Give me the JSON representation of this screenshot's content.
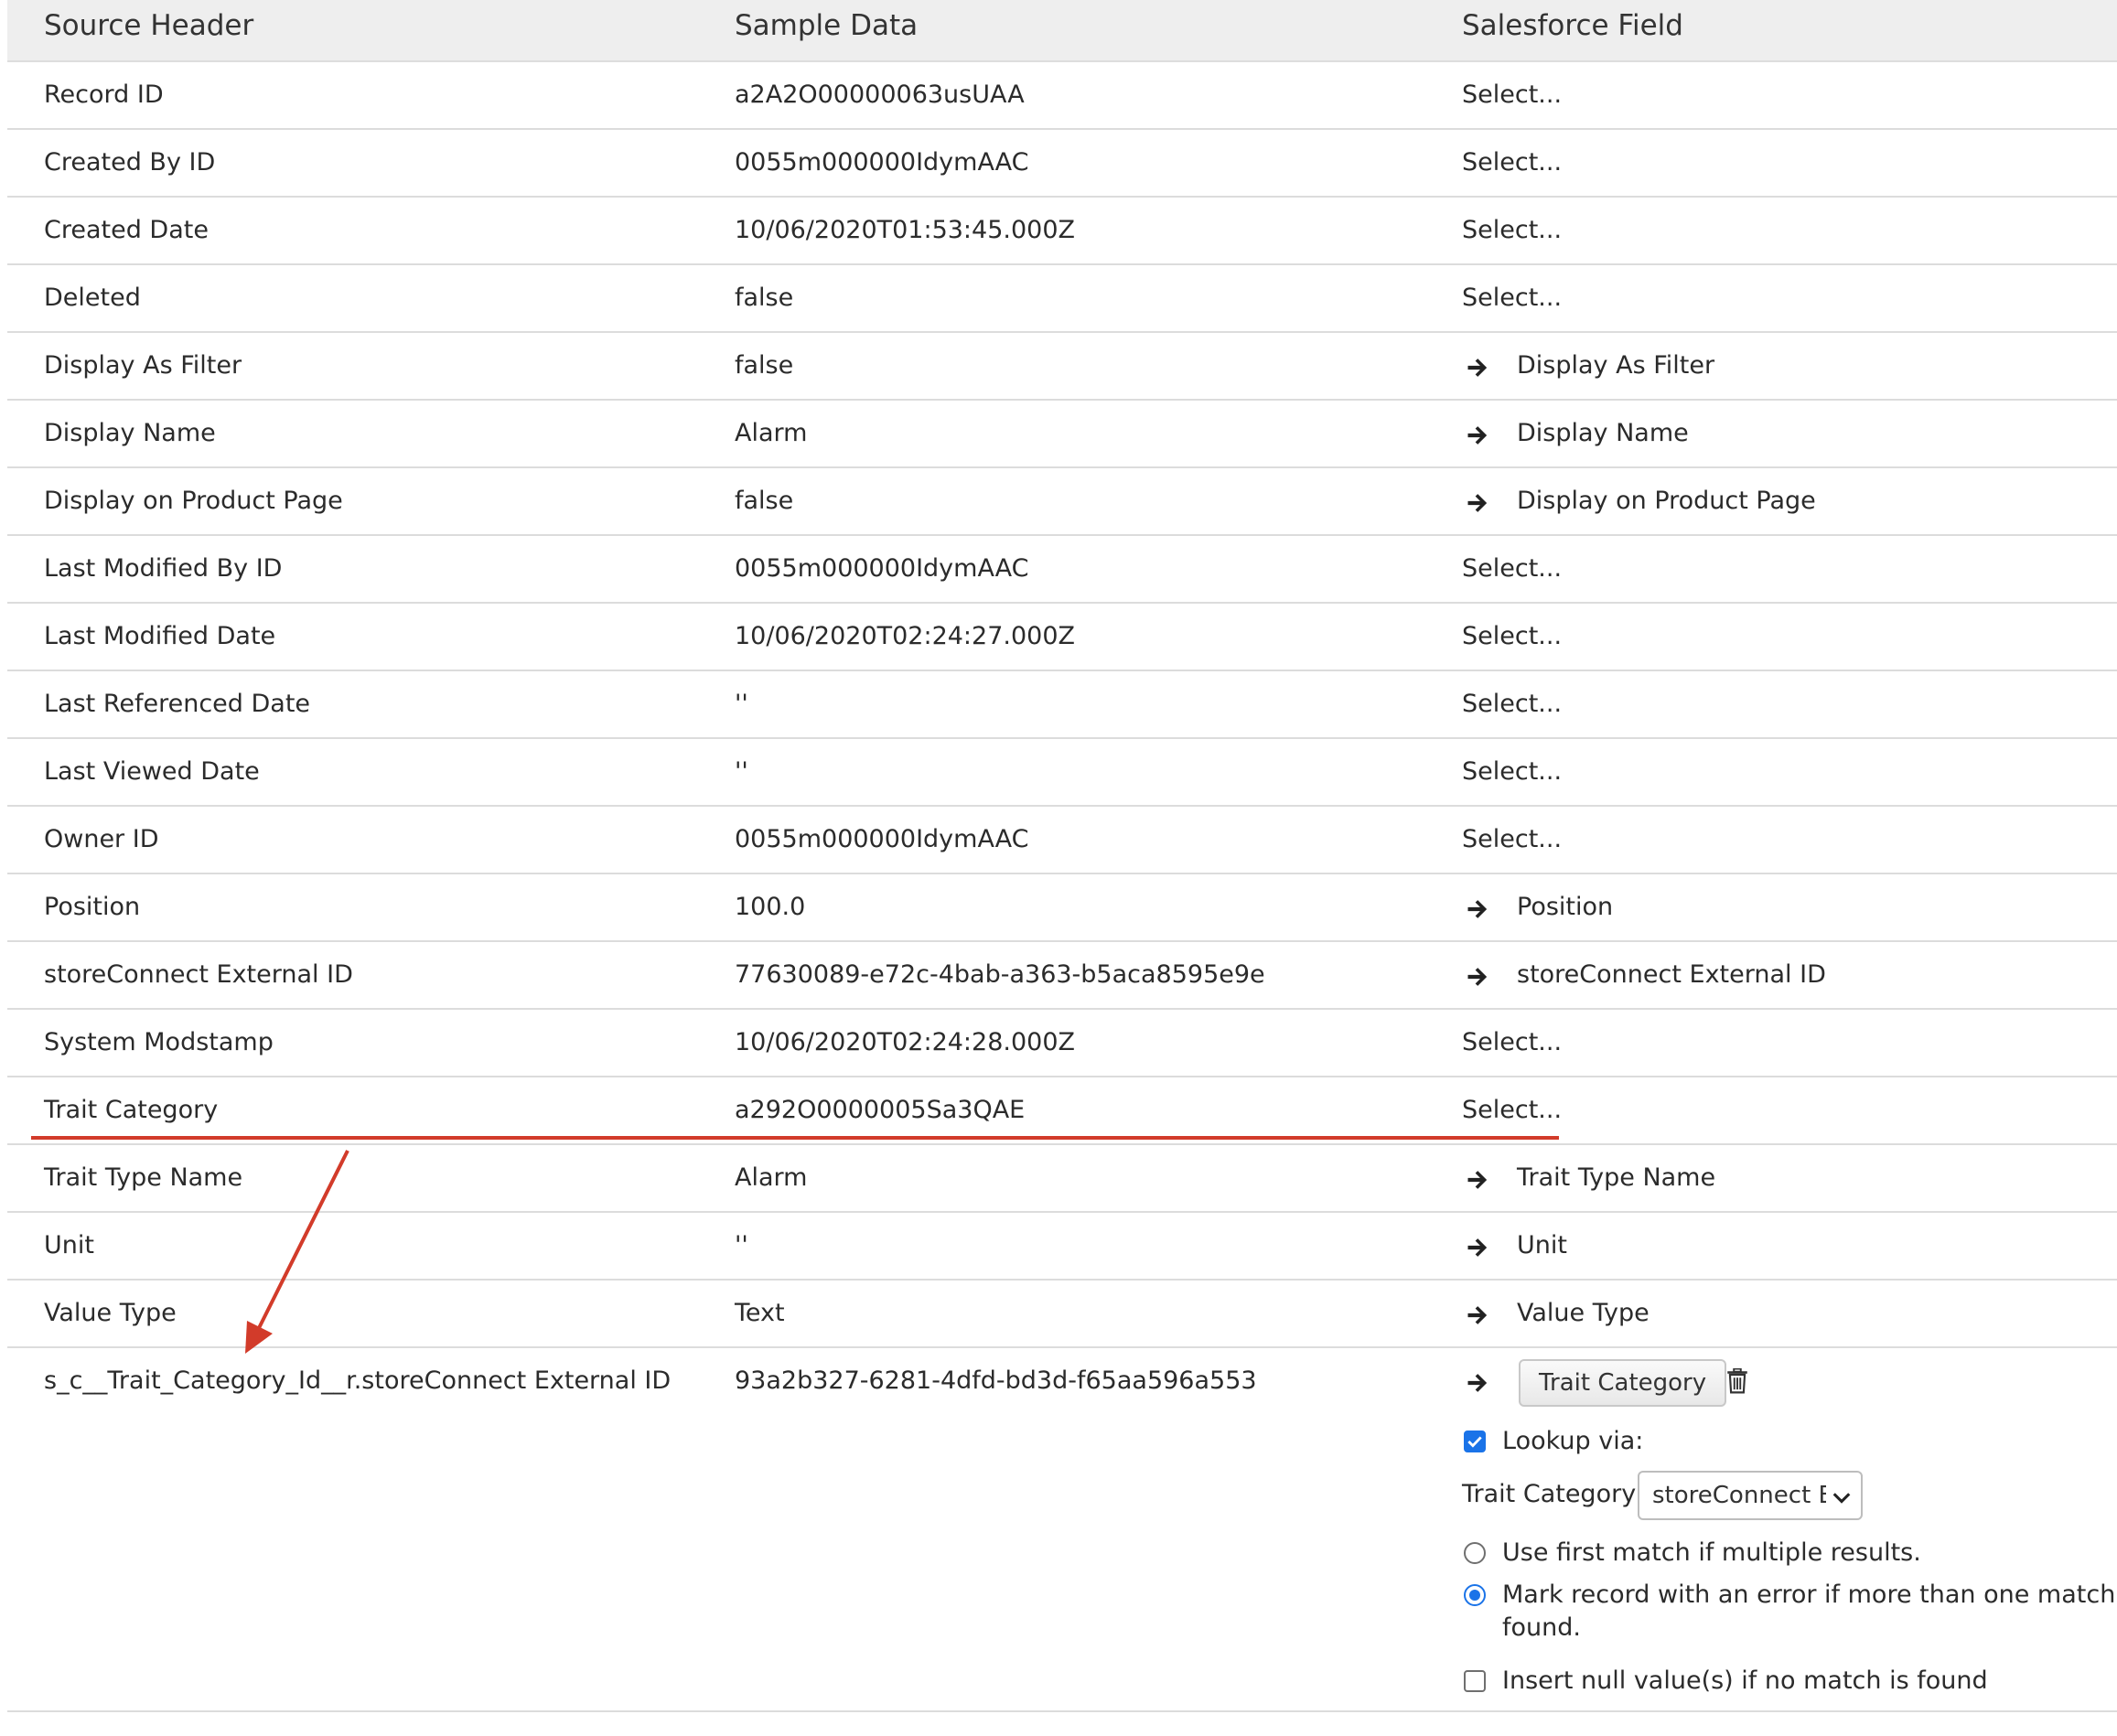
{
  "header": {
    "source_header": "Source Header",
    "sample_data": "Sample Data",
    "salesforce_field": "Salesforce Field"
  },
  "rows": [
    {
      "source": "Record ID",
      "sample": "a2A2O00000063usUAA",
      "field": "Select...",
      "mapped": false
    },
    {
      "source": "Created By ID",
      "sample": "0055m000000IdymAAC",
      "field": "Select...",
      "mapped": false
    },
    {
      "source": "Created Date",
      "sample": "10/06/2020T01:53:45.000Z",
      "field": "Select...",
      "mapped": false
    },
    {
      "source": "Deleted",
      "sample": "false",
      "field": "Select...",
      "mapped": false
    },
    {
      "source": "Display As Filter",
      "sample": "false",
      "field": "Display As Filter",
      "mapped": true
    },
    {
      "source": "Display Name",
      "sample": "Alarm",
      "field": "Display Name",
      "mapped": true
    },
    {
      "source": "Display on Product Page",
      "sample": "false",
      "field": "Display on Product Page",
      "mapped": true
    },
    {
      "source": "Last Modified By ID",
      "sample": "0055m000000IdymAAC",
      "field": "Select...",
      "mapped": false
    },
    {
      "source": "Last Modified Date",
      "sample": "10/06/2020T02:24:27.000Z",
      "field": "Select...",
      "mapped": false
    },
    {
      "source": "Last Referenced Date",
      "sample": "''",
      "field": "Select...",
      "mapped": false
    },
    {
      "source": "Last Viewed Date",
      "sample": "''",
      "field": "Select...",
      "mapped": false
    },
    {
      "source": "Owner ID",
      "sample": "0055m000000IdymAAC",
      "field": "Select...",
      "mapped": false
    },
    {
      "source": "Position",
      "sample": "100.0",
      "field": "Position",
      "mapped": true
    },
    {
      "source": "storeConnect External ID",
      "sample": "77630089-e72c-4bab-a363-b5aca8595e9e",
      "field": "storeConnect External ID",
      "mapped": true
    },
    {
      "source": "System Modstamp",
      "sample": "10/06/2020T02:24:28.000Z",
      "field": "Select...",
      "mapped": false
    },
    {
      "source": "Trait Category",
      "sample": "a292O0000005Sa3QAE",
      "field": "Select...",
      "mapped": false
    },
    {
      "source": "Trait Type Name",
      "sample": "Alarm",
      "field": "Trait Type Name",
      "mapped": true
    },
    {
      "source": "Unit",
      "sample": "''",
      "field": "Unit",
      "mapped": true
    },
    {
      "source": "Value Type",
      "sample": "Text",
      "field": "Value Type",
      "mapped": true
    }
  ],
  "lookup_row": {
    "source": "s_c__Trait_Category_Id__r.storeConnect External ID",
    "sample": "93a2b327-6281-4dfd-bd3d-f65aa596a553",
    "field_button": "Trait Category",
    "lookup_via_label": "Lookup via:",
    "lookup_via_checked": true,
    "lookup_object_label": "Trait Category",
    "lookup_select_value": "storeConnect External ID",
    "radio_first_match": "Use first match if multiple results.",
    "radio_error_line1": "Mark record with an error if more than one match is",
    "radio_error_line2": "found.",
    "radio_selected": "error",
    "insert_null_label": "Insert null value(s) if no match is found",
    "insert_null_checked": false
  },
  "icons": {
    "mapped_arrow": "arrow-right-icon",
    "delete": "trash-icon",
    "dropdown": "chevron-down-icon"
  },
  "colors": {
    "header_bg": "#eeeeee",
    "accent_blue": "#1a73e8",
    "annotation_red": "#d23b2a"
  }
}
